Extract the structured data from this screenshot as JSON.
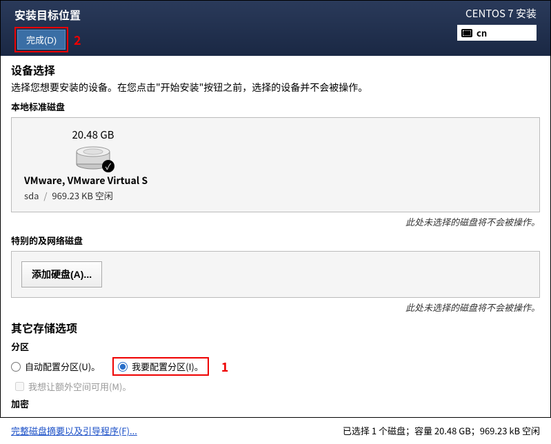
{
  "header": {
    "title": "安装目标位置",
    "done_label": "完成(D)",
    "distro": "CENTOS 7 安装",
    "lang": "cn"
  },
  "annotations": {
    "done": "2",
    "partition": "1"
  },
  "device": {
    "title": "设备选择",
    "subtitle": "选择您想要安装的设备。在您点击\"开始安装\"按钮之前，选择的设备并不会被操作。",
    "local_heading": "本地标准磁盘",
    "disk": {
      "size": "20.48 GB",
      "name": "VMware, VMware Virtual S",
      "id": "sda",
      "free": "969.23 KB 空闲"
    },
    "hint": "此处未选择的磁盘将不会被操作。",
    "special_heading": "特别的及网络磁盘",
    "add_disk_label": "添加硬盘(A)..."
  },
  "storage": {
    "title": "其它存储选项",
    "partition_heading": "分区",
    "auto_label": "自动配置分区(U)。",
    "manual_label": "我要配置分区(I)。",
    "extra_space_label": "我想让额外空间可用(M)。",
    "encrypt_heading": "加密"
  },
  "footer": {
    "link": "完整磁盘摘要以及引导程序(F)...",
    "summary": "已选择 1 个磁盘；容量 20.48 GB；969.23 kB 空闲"
  }
}
